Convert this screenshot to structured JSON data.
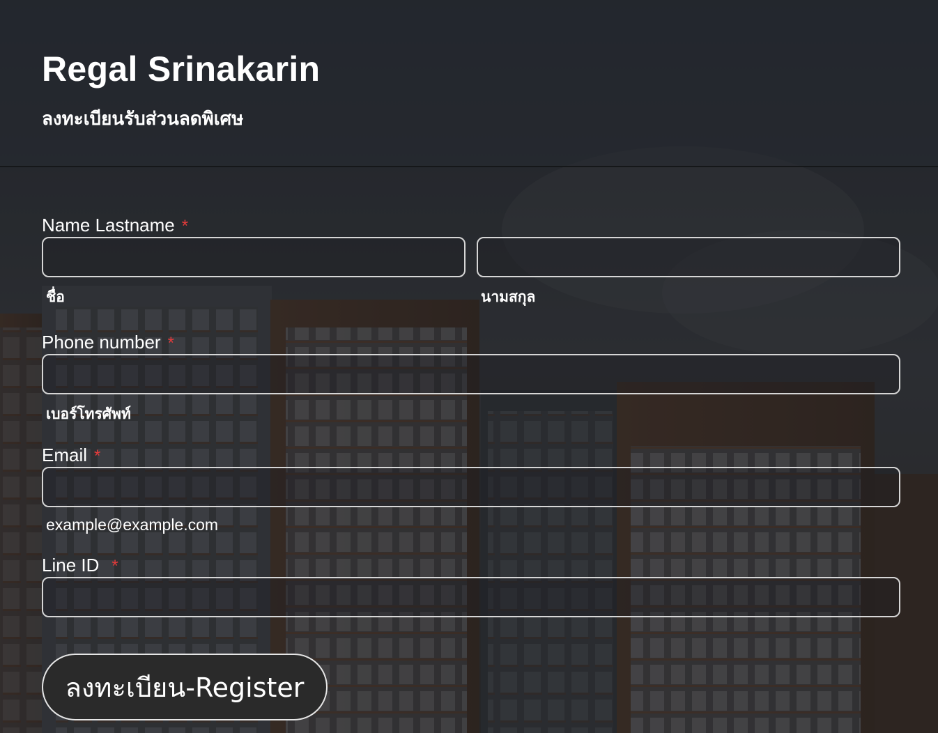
{
  "header": {
    "title": "Regal Srinakarin",
    "subtitle": "ลงทะเบียนรับส่วนลดพิเศษ"
  },
  "form": {
    "name": {
      "label": "Name Lastname",
      "required_mark": "*",
      "first_value": "",
      "last_value": "",
      "first_sublabel": "ชื่อ",
      "last_sublabel": "นามสกุล"
    },
    "phone": {
      "label": "Phone number",
      "required_mark": "*",
      "value": "",
      "sublabel": "เบอร์โทรศัพท์"
    },
    "email": {
      "label": "Email",
      "required_mark": "*",
      "value": "",
      "sublabel": "example@example.com"
    },
    "line_id": {
      "label": "Line ID",
      "required_mark": "*",
      "value": ""
    },
    "submit_label": "ลงทะเบียน-Register"
  },
  "colors": {
    "required": "#e53b3b",
    "button_bg": "#2a2a2a",
    "input_border": "#d6d6d6"
  }
}
